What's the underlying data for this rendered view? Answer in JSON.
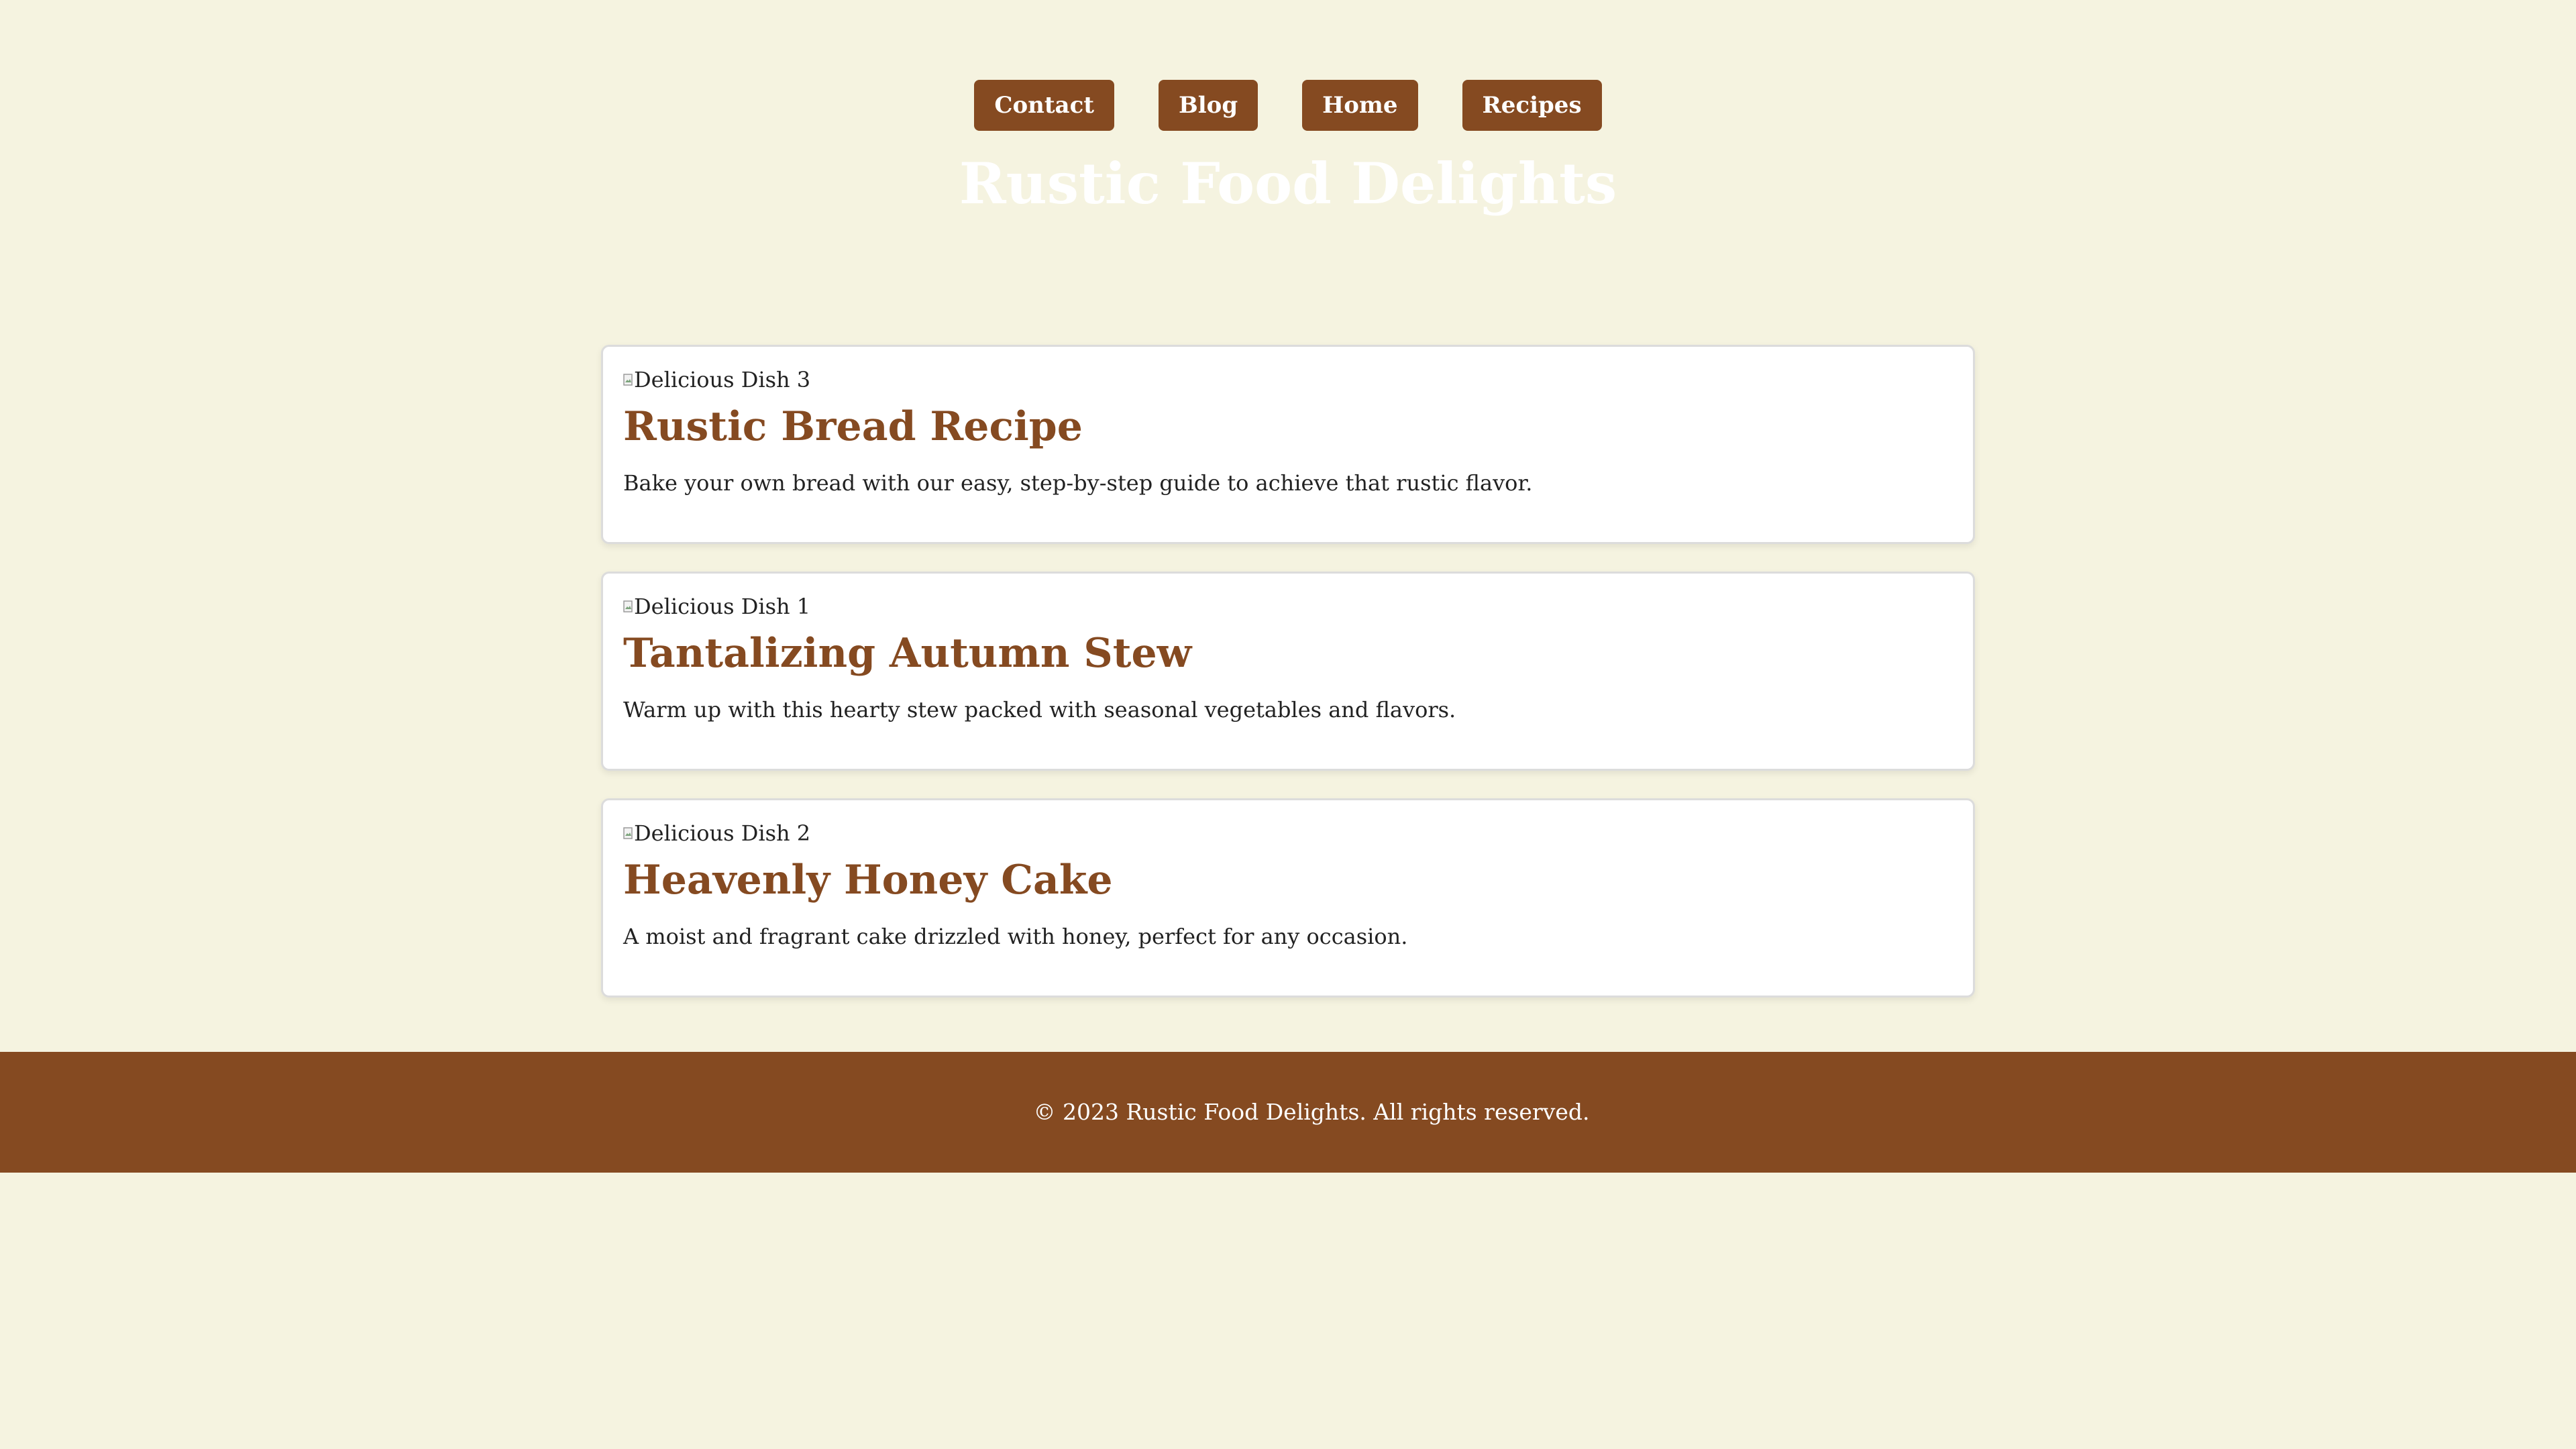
{
  "nav": {
    "items": [
      {
        "label": "Contact"
      },
      {
        "label": "Blog"
      },
      {
        "label": "Home"
      },
      {
        "label": "Recipes"
      }
    ]
  },
  "header": {
    "title": "Rustic Food Delights"
  },
  "recipes": [
    {
      "image_alt": "Delicious Dish 3",
      "title": "Rustic Bread Recipe",
      "description": "Bake your own bread with our easy, step-by-step guide to achieve that rustic flavor."
    },
    {
      "image_alt": "Delicious Dish 1",
      "title": "Tantalizing Autumn Stew",
      "description": "Warm up with this hearty stew packed with seasonal vegetables and flavors."
    },
    {
      "image_alt": "Delicious Dish 2",
      "title": "Heavenly Honey Cake",
      "description": "A moist and fragrant cake drizzled with honey, perfect for any occasion."
    }
  ],
  "footer": {
    "text": "© 2023 Rustic Food Delights. All rights reserved."
  },
  "colors": {
    "background": "#f5f3e0",
    "accent": "#854a21",
    "card": "#ffffff",
    "title": "#ffffff"
  },
  "icons": {
    "broken_image": "broken-image-icon"
  }
}
